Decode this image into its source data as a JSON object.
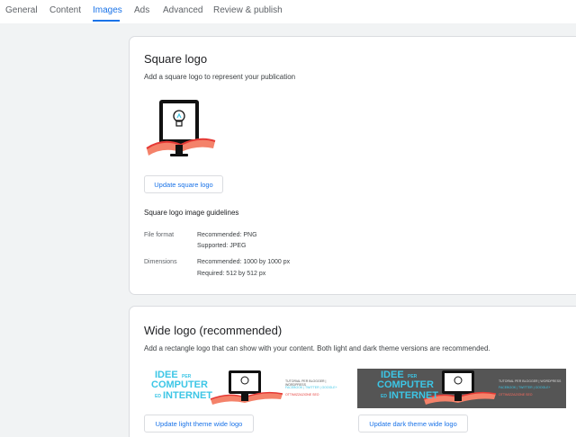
{
  "tabs": {
    "items": [
      {
        "label": "General"
      },
      {
        "label": "Content"
      },
      {
        "label": "Images",
        "active": true
      },
      {
        "label": "Ads"
      },
      {
        "label": "Advanced"
      },
      {
        "label": "Review & publish"
      }
    ]
  },
  "square_logo": {
    "title": "Square logo",
    "description": "Add a square logo to represent your publication",
    "update_button": "Update square logo",
    "guidelines_title": "Square logo image guidelines",
    "file_format_label": "File format",
    "file_format_recommended": "Recommended: PNG",
    "file_format_supported": "Supported: JPEG",
    "dimensions_label": "Dimensions",
    "dimensions_recommended": "Recommended: 1000 by 1000 px",
    "dimensions_required": "Required: 512 by 512 px"
  },
  "wide_logo": {
    "title": "Wide logo (recommended)",
    "description": "Add a rectangle logo that can show with your content. Both light and dark theme versions are recommended.",
    "light_button": "Update light theme wide logo",
    "dark_button": "Update dark theme wide logo",
    "logo_text_1": "IDEE",
    "logo_text_per": "PER",
    "logo_text_2": "COMPUTER",
    "logo_text_ed": "ED",
    "logo_text_3": "INTERNET",
    "logo_tagline_1": "TUTORIAL PER BLOGGER | WORDPRESS",
    "logo_tagline_2": "FACEBOOK | TWITTER | GOOGLE+",
    "logo_tagline_3": "OTTIMIZZAZIONE SEO"
  },
  "colors": {
    "accent": "#1a73e8",
    "logo_cyan": "#3cc6e6",
    "logo_red": "#e53935",
    "logo_ribbon": "#f4826a",
    "dark_bg": "#555555"
  }
}
